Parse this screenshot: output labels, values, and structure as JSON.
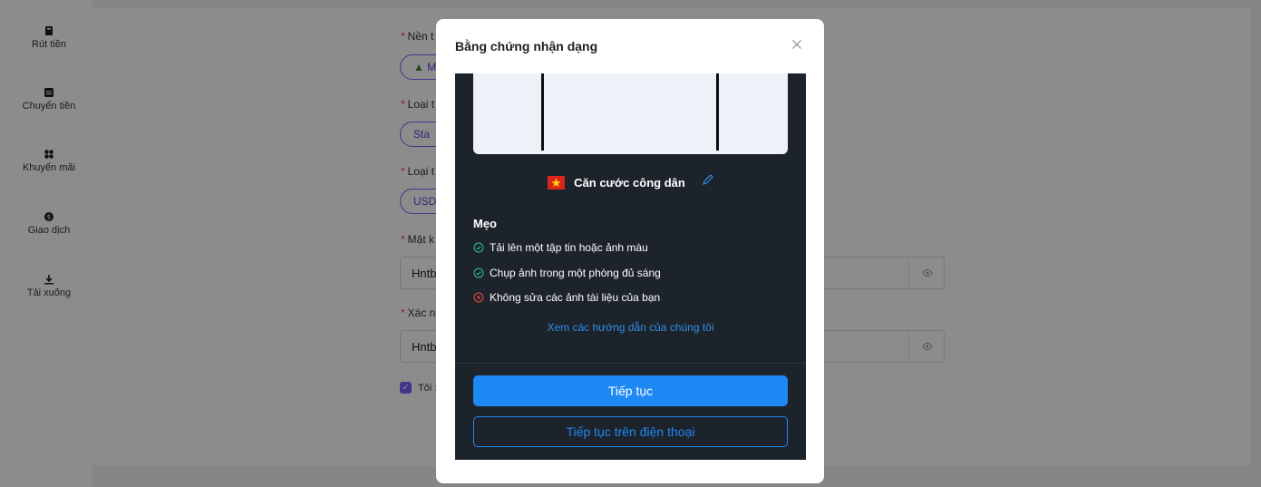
{
  "sidebar": {
    "items": [
      {
        "label": "Rút tiền",
        "icon": "withdraw-icon"
      },
      {
        "label": "Chuyển tiền",
        "icon": "transfer-icon"
      },
      {
        "label": "Khuyến mãi",
        "icon": "promotion-icon"
      },
      {
        "label": "Giao dịch",
        "icon": "transaction-icon"
      },
      {
        "label": "Tải xuống",
        "icon": "download-icon"
      }
    ]
  },
  "form": {
    "labels": [
      "Nền t",
      "Loại t",
      "Loại t",
      "Mật k",
      "Xác n"
    ],
    "platform_pill": "M",
    "type_pill": "Sta",
    "currency_pill": "USD",
    "password_value": "Hntb",
    "confirm_value": "Hntb",
    "agree_text": "Tôi :"
  },
  "modal": {
    "title": "Bằng chứng nhận dạng",
    "document_type": "Căn cước công dân",
    "tips_title": "Mẹo",
    "tips": [
      {
        "text": "Tải lên một tập tin hoặc ảnh màu",
        "status": "ok"
      },
      {
        "text": "Chụp ảnh trong một phòng đủ sáng",
        "status": "ok"
      },
      {
        "text": "Không sửa các ảnh tài liệu của bạn",
        "status": "bad"
      }
    ],
    "guide_link": "Xem các hướng dẫn của chúng tôi",
    "continue_button": "Tiếp tục",
    "continue_phone_button": "Tiếp tục trên điện thoại"
  },
  "colors": {
    "accent": "#1e88f5",
    "purple": "#7b61ff",
    "ok": "#2ec4a5",
    "bad": "#f0494a",
    "panel": "#1d232b"
  }
}
